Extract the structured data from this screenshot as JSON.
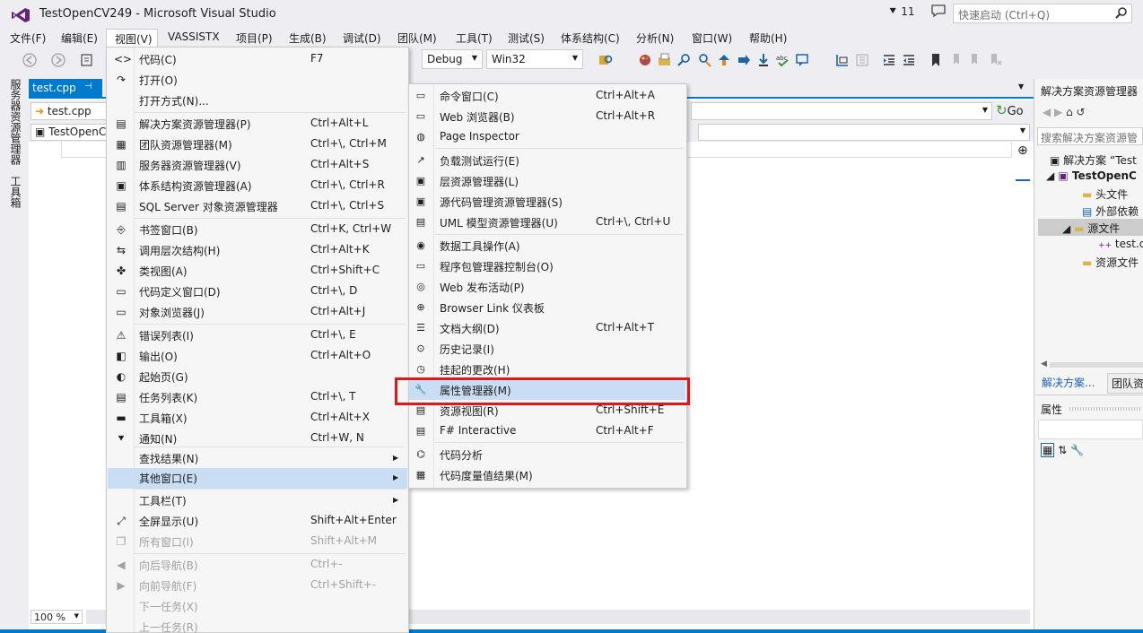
{
  "window": {
    "title": "TestOpenCV249 - Microsoft Visual Studio",
    "notifications": "11",
    "quick_launch_placeholder": "快速启动 (Ctrl+Q)"
  },
  "menubar": [
    "文件(F)",
    "编辑(E)",
    "视图(V)",
    "VASSISTX",
    "项目(P)",
    "生成(B)",
    "调试(D)",
    "团队(M)",
    "工具(T)",
    "测试(S)",
    "体系结构(C)",
    "分析(N)",
    "窗口(W)",
    "帮助(H)"
  ],
  "toolbar": {
    "config": "Debug",
    "platform": "Win32"
  },
  "left_strip": {
    "server_explorer": "服务器资源管理器",
    "toolbox": "工具箱"
  },
  "editor": {
    "tab_label": "test.cpp",
    "nav1": "test.cpp",
    "nav2": "TestOpenCV",
    "go_label": "Go",
    "zoom": "100 %"
  },
  "solution_panel": {
    "title": "解决方案资源管理器",
    "search_placeholder": "搜索解决方案资源管",
    "tree": [
      "解决方案 “Test",
      "TestOpenC",
      "头文件",
      "外部依赖",
      "源文件",
      "test.c",
      "资源文件"
    ],
    "bottom_tabs": [
      "解决方案...",
      "团队资"
    ],
    "properties_title": "属性"
  },
  "view_menu": {
    "items": [
      {
        "label": "代码(C)",
        "shortcut": "F7",
        "icon": "code-icon"
      },
      {
        "label": "打开(O)",
        "shortcut": "",
        "icon": "open-icon"
      },
      {
        "label": "打开方式(N)...",
        "shortcut": "",
        "icon": ""
      },
      {
        "label": "解决方案资源管理器(P)",
        "shortcut": "Ctrl+Alt+L",
        "icon": "solution-explorer-icon"
      },
      {
        "label": "团队资源管理器(M)",
        "shortcut": "Ctrl+\\, Ctrl+M",
        "icon": "team-explorer-icon"
      },
      {
        "label": "服务器资源管理器(V)",
        "shortcut": "Ctrl+Alt+S",
        "icon": "server-explorer-icon"
      },
      {
        "label": "体系结构资源管理器(A)",
        "shortcut": "Ctrl+\\, Ctrl+R",
        "icon": "architecture-explorer-icon"
      },
      {
        "label": "SQL Server 对象资源管理器",
        "shortcut": "Ctrl+\\, Ctrl+S",
        "icon": "sql-server-icon"
      },
      {
        "label": "书签窗口(B)",
        "shortcut": "Ctrl+K, Ctrl+W",
        "icon": "bookmark-window-icon"
      },
      {
        "label": "调用层次结构(H)",
        "shortcut": "Ctrl+Alt+K",
        "icon": "call-hierarchy-icon"
      },
      {
        "label": "类视图(A)",
        "shortcut": "Ctrl+Shift+C",
        "icon": "class-view-icon"
      },
      {
        "label": "代码定义窗口(D)",
        "shortcut": "Ctrl+\\, D",
        "icon": "code-definition-icon"
      },
      {
        "label": "对象浏览器(J)",
        "shortcut": "Ctrl+Alt+J",
        "icon": "object-browser-icon"
      },
      {
        "label": "错误列表(I)",
        "shortcut": "Ctrl+\\, E",
        "icon": "error-list-icon"
      },
      {
        "label": "输出(O)",
        "shortcut": "Ctrl+Alt+O",
        "icon": "output-icon"
      },
      {
        "label": "起始页(G)",
        "shortcut": "",
        "icon": "start-page-icon"
      },
      {
        "label": "任务列表(K)",
        "shortcut": "Ctrl+\\, T",
        "icon": "task-list-icon"
      },
      {
        "label": "工具箱(X)",
        "shortcut": "Ctrl+Alt+X",
        "icon": "toolbox-icon"
      },
      {
        "label": "通知(N)",
        "shortcut": "Ctrl+W, N",
        "icon": "notifications-icon"
      },
      {
        "label": "查找结果(N)",
        "shortcut": "",
        "icon": ""
      },
      {
        "label": "其他窗口(E)",
        "shortcut": "",
        "icon": ""
      },
      {
        "label": "工具栏(T)",
        "shortcut": "",
        "icon": ""
      },
      {
        "label": "全屏显示(U)",
        "shortcut": "Shift+Alt+Enter",
        "icon": "full-screen-icon"
      },
      {
        "label": "所有窗口(l)",
        "shortcut": "Shift+Alt+M",
        "icon": "all-windows-icon"
      },
      {
        "label": "向后导航(B)",
        "shortcut": "Ctrl+-",
        "icon": "navigate-back-icon"
      },
      {
        "label": "向前导航(F)",
        "shortcut": "Ctrl+Shift+-",
        "icon": "navigate-forward-icon"
      },
      {
        "label": "下一任务(X)",
        "shortcut": "",
        "icon": ""
      },
      {
        "label": "上一任务(R)",
        "shortcut": "",
        "icon": ""
      }
    ]
  },
  "other_windows_menu": {
    "items": [
      {
        "label": "命令窗口(C)",
        "shortcut": "Ctrl+Alt+A"
      },
      {
        "label": "Web 浏览器(B)",
        "shortcut": "Ctrl+Alt+R"
      },
      {
        "label": "Page Inspector",
        "shortcut": ""
      },
      {
        "label": "负载测试运行(E)",
        "shortcut": ""
      },
      {
        "label": "层资源管理器(L)",
        "shortcut": ""
      },
      {
        "label": "源代码管理资源管理器(S)",
        "shortcut": ""
      },
      {
        "label": "UML 模型资源管理器(U)",
        "shortcut": "Ctrl+\\, Ctrl+U"
      },
      {
        "label": "数据工具操作(A)",
        "shortcut": ""
      },
      {
        "label": "程序包管理器控制台(O)",
        "shortcut": ""
      },
      {
        "label": "Web 发布活动(P)",
        "shortcut": ""
      },
      {
        "label": "Browser Link 仪表板",
        "shortcut": ""
      },
      {
        "label": "文档大纲(D)",
        "shortcut": "Ctrl+Alt+T"
      },
      {
        "label": "历史记录(I)",
        "shortcut": ""
      },
      {
        "label": "挂起的更改(H)",
        "shortcut": ""
      },
      {
        "label": "属性管理器(M)",
        "shortcut": ""
      },
      {
        "label": "资源视图(R)",
        "shortcut": "Ctrl+Shift+E"
      },
      {
        "label": "F# Interactive",
        "shortcut": "Ctrl+Alt+F"
      },
      {
        "label": "代码分析",
        "shortcut": ""
      },
      {
        "label": "代码度量值结果(M)",
        "shortcut": ""
      }
    ]
  }
}
